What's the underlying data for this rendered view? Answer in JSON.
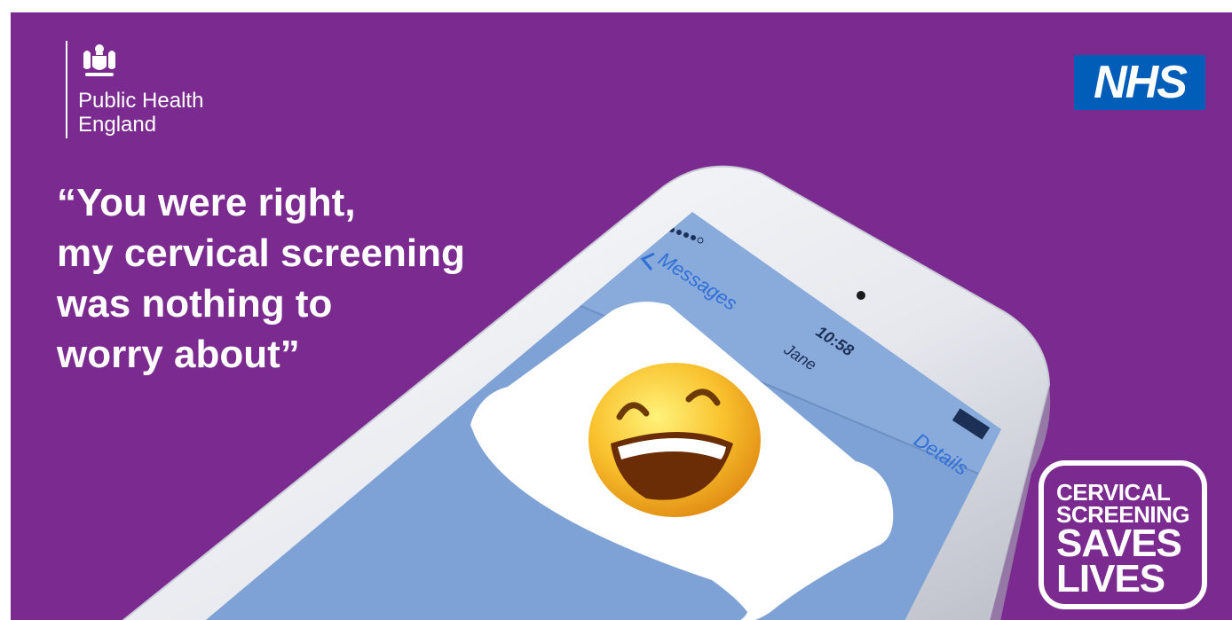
{
  "header": {
    "phe_logo_lines": [
      "Public Health",
      "England"
    ],
    "nhs_logo_text": "NHS"
  },
  "headline": {
    "lines": [
      "“You were right,",
      "my cervical screening",
      "was nothing to",
      "worry about”"
    ]
  },
  "phone": {
    "back_label": "Messages",
    "time": "10:58",
    "contact_name": "Jane",
    "details_label": "Details",
    "message_icon": "grinning-face-emoji"
  },
  "badge": {
    "line1": "CERVICAL",
    "line2": "SCREENING",
    "line3": "SAVES",
    "line4": "LIVES"
  },
  "colors": {
    "background": "#7b2b8f",
    "nhs_blue": "#005eb8",
    "screen_blue": "#7ea2d6",
    "ios_blue": "#2f6fd6",
    "text": "#ffffff"
  }
}
